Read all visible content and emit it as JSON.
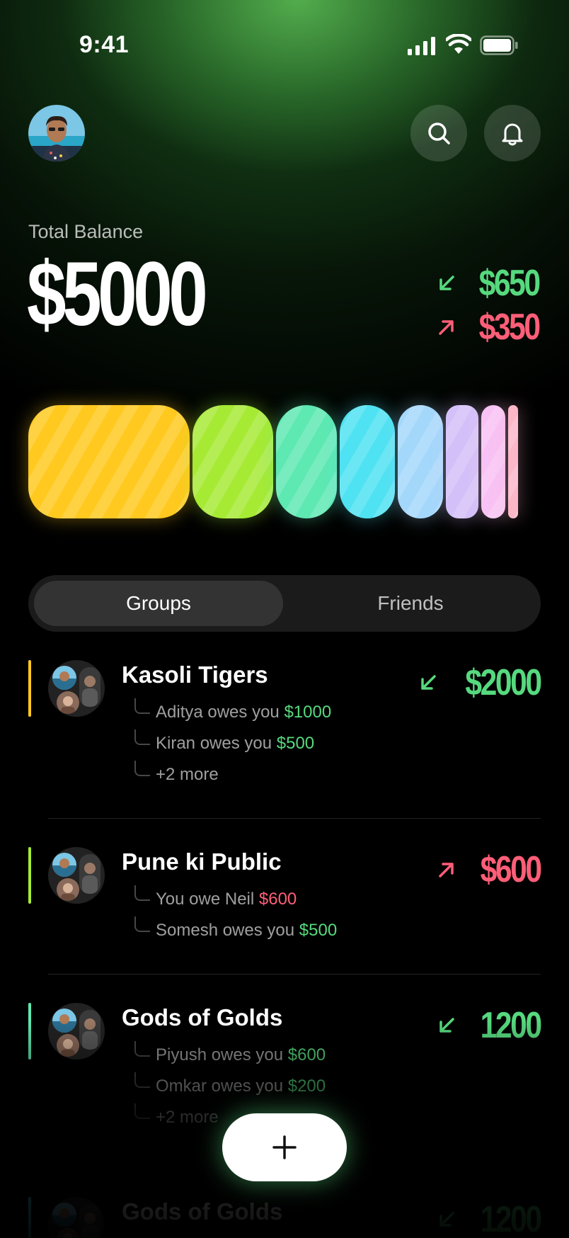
{
  "status_bar": {
    "time": "9:41"
  },
  "header": {
    "avatar": "user-avatar",
    "search_icon": "search-icon",
    "bell_icon": "bell-icon"
  },
  "balance": {
    "label": "Total Balance",
    "amount": "$5000",
    "incoming": "$650",
    "outgoing": "$350"
  },
  "spending_bar": {
    "segments": [
      {
        "color": "#ffc91f"
      },
      {
        "color": "#a6ea34"
      },
      {
        "color": "#5ee8b2"
      },
      {
        "color": "#4fe2f2"
      },
      {
        "color": "#a4d8fb"
      },
      {
        "color": "#d4c0f8"
      },
      {
        "color": "#f8c2f4"
      },
      {
        "color": "#fbb6c8"
      }
    ]
  },
  "tabs": {
    "groups": "Groups",
    "friends": "Friends"
  },
  "groups": [
    {
      "name": "Kasoli Tigers",
      "amount": "$2000",
      "direction": "in",
      "accent": "#ffc91f",
      "lines": [
        {
          "text": "Aditya owes you ",
          "value": "$1000"
        },
        {
          "text": "Kiran owes you ",
          "value": "$500"
        },
        {
          "text": "+2 more",
          "value": ""
        }
      ]
    },
    {
      "name": "Pune ki Public",
      "amount": "$600",
      "direction": "out",
      "accent": "#a6ea34",
      "lines": [
        {
          "text": "You owe Neil ",
          "value": "$600"
        },
        {
          "text": "Somesh owes you ",
          "value": "$500"
        }
      ]
    },
    {
      "name": "Gods of Golds",
      "amount": "1200",
      "direction": "in",
      "accent": "#5ee8b2",
      "lines": [
        {
          "text": "Piyush owes you ",
          "value": "$600"
        },
        {
          "text": "Omkar owes you ",
          "value": "$200"
        },
        {
          "text": "+2 more",
          "value": ""
        }
      ]
    },
    {
      "name": "Gods of Golds",
      "amount": "1200",
      "direction": "in",
      "accent": "#4fe2f2",
      "lines": []
    }
  ],
  "fab": {
    "icon": "plus-icon"
  }
}
